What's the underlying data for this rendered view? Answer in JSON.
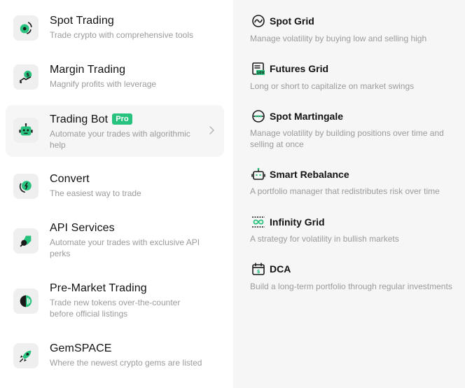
{
  "colors": {
    "accent": "#27c27d",
    "title_text": "#121212",
    "desc_text": "#9b9b9b",
    "tile_bg": "#efefef",
    "panel_bg": "#f6f6f6"
  },
  "menu": {
    "items": [
      {
        "title": "Spot Trading",
        "desc": "Trade crypto with comprehensive tools",
        "icon": "spot-trading-icon"
      },
      {
        "title": "Margin Trading",
        "desc": "Magnify profits with leverage",
        "icon": "margin-trading-icon"
      },
      {
        "title": "Trading Bot",
        "badge": "Pro",
        "desc": "Automate your trades with algorithmic help",
        "icon": "robot-icon",
        "active": true
      },
      {
        "title": "Convert",
        "desc": "The easiest way to trade",
        "icon": "convert-icon"
      },
      {
        "title": "API Services",
        "desc": "Automate your trades with exclusive API perks",
        "icon": "api-icon"
      },
      {
        "title": "Pre-Market Trading",
        "desc": "Trade new tokens over-the-counter before official listings",
        "icon": "pre-market-icon"
      },
      {
        "title": "GemSPACE",
        "desc": "Where the newest crypto gems are listed",
        "icon": "rocket-icon"
      }
    ]
  },
  "bots": {
    "items": [
      {
        "title": "Spot Grid",
        "desc": "Manage volatility by buying low and selling high",
        "icon": "wave-icon"
      },
      {
        "title": "Futures Grid",
        "desc": "Long or short to capitalize on market swings",
        "icon": "futures-grid-icon",
        "icon_text": "10X"
      },
      {
        "title": "Spot Martingale",
        "desc": "Manage volatility by building positions over time and selling at once",
        "icon": "martingale-icon"
      },
      {
        "title": "Smart Rebalance",
        "desc": "A portfolio manager that redistributes risk over time",
        "icon": "rebalance-robot-icon"
      },
      {
        "title": "Infinity Grid",
        "desc": "A strategy for volatility in bullish markets",
        "icon": "infinity-icon"
      },
      {
        "title": "DCA",
        "desc": "Build a long-term portfolio through regular investments",
        "icon": "calendar-dollar-icon"
      }
    ]
  }
}
